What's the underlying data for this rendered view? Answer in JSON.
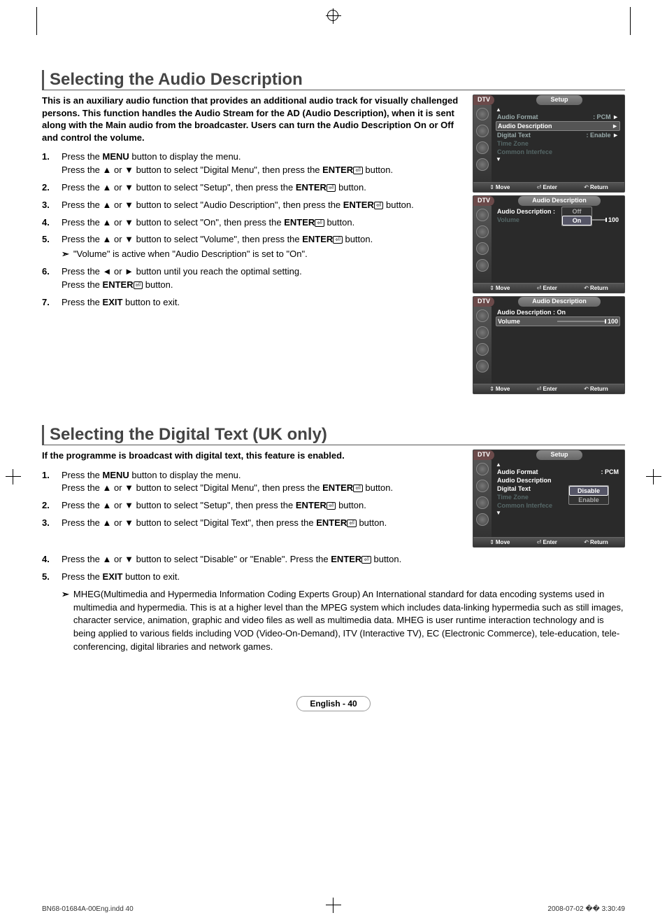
{
  "section1": {
    "title": "Selecting the Audio Description",
    "lead": "This is an auxiliary audio function that provides an additional audio track for visually challenged persons. This function handles the Audio Stream for the AD (Audio Description), when it is sent along with the Main audio from the broadcaster. Users can turn the Audio Description On or Off and control the volume.",
    "steps": [
      {
        "n": "1.",
        "t": "Press the <b>MENU</b> button to display the menu.<br>Press the ▲ or ▼ button to select \"Digital Menu\", then press the <b>ENTER</b><span class='enter-icon'>⏎</span> button."
      },
      {
        "n": "2.",
        "t": "Press the ▲ or ▼ button to select \"Setup\", then press the <b>ENTER</b><span class='enter-icon'>⏎</span> button."
      },
      {
        "n": "3.",
        "t": "Press the ▲ or ▼ button to select \"Audio Description\", then press the <b>ENTER</b><span class='enter-icon'>⏎</span> button."
      },
      {
        "n": "4.",
        "t": "Press the ▲ or ▼ button to select \"On\", then press the <b>ENTER</b><span class='enter-icon'>⏎</span> button."
      },
      {
        "n": "5.",
        "t": "Press the ▲ or ▼ button to select \"Volume\", then press the <b>ENTER</b><span class='enter-icon'>⏎</span> button.",
        "note": "\"Volume\" is active when \"Audio Description\" is set to \"On\"."
      },
      {
        "n": "6.",
        "t": "Press the ◄ or ► button until you reach the optimal setting.<br>Press the <b>ENTER</b><span class='enter-icon'>⏎</span> button."
      },
      {
        "n": "7.",
        "t": "Press the <b>EXIT</b> button to exit."
      }
    ]
  },
  "section2": {
    "title": "Selecting the Digital Text (UK only)",
    "lead": "If the programme is broadcast with digital text, this feature is enabled.",
    "steps": [
      {
        "n": "1.",
        "t": "Press the <b>MENU</b> button to display the menu.<br>Press the ▲ or ▼ button to select \"Digital Menu\", then press the <b>ENTER</b><span class='enter-icon'>⏎</span> button."
      },
      {
        "n": "2.",
        "t": "Press the ▲ or ▼ button to select \"Setup\", then press the <b>ENTER</b><span class='enter-icon'>⏎</span> button."
      },
      {
        "n": "3.",
        "t": "Press the ▲ or ▼ button to select \"Digital Text\", then press the <b>ENTER</b><span class='enter-icon'>⏎</span> button."
      }
    ],
    "wide_steps": [
      {
        "n": "4.",
        "t": "Press the ▲ or ▼ button to select \"Disable\" or \"Enable\". Press the <b>ENTER</b><span class='enter-icon'>⏎</span> button."
      },
      {
        "n": "5.",
        "t": "Press the <b>EXIT</b> button to exit."
      }
    ],
    "mheg_note": "MHEG(Multimedia and Hypermedia Information Coding Experts Group) An International standard for data encoding systems used in multimedia and hypermedia. This is at a higher level than the MPEG system which includes data-linking hypermedia such as still images, character service, animation, graphic and video files as well as multimedia data. MHEG is user runtime interaction technology and is being applied to various fields including VOD (Video-On-Demand), ITV (Interactive TV), EC (Electronic Commerce), tele-education, tele-conferencing, digital libraries and network games."
  },
  "osd": {
    "dtv": "DTV",
    "setup": "Setup",
    "audio_desc": "Audio Description",
    "audio_format": "Audio Format",
    "pcm": ": PCM",
    "digital_text": "Digital Text",
    "enable": ": Enable",
    "time_zone": "Time Zone",
    "common_if": "Common Interfece",
    "volume": "Volume",
    "on": "On",
    "off": "Off",
    "disable": "Disable",
    "enable2": "Enable",
    "val100": "100",
    "ad_on": "Audio Description : On",
    "move": "Move",
    "enter": "Enter",
    "return": "Return"
  },
  "pagelabel": "English - 40",
  "footer": {
    "left": "BN68-01684A-00Eng.indd   40",
    "right": "2008-07-02   �� 3:30:49"
  }
}
